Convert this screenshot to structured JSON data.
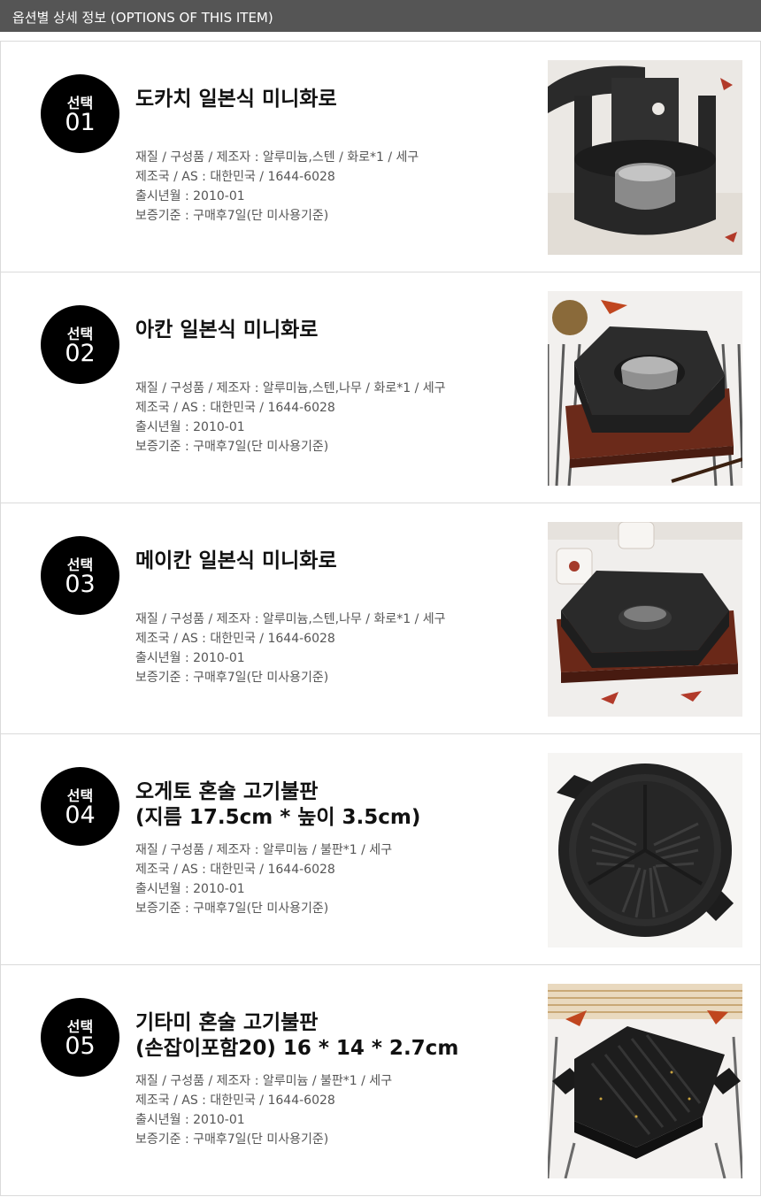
{
  "header": {
    "title": "옵션별 상세 정보 (OPTIONS OF THIS ITEM)"
  },
  "items": [
    {
      "badge_label": "선택",
      "number": "01",
      "title_line1": "도카치 일본식 미니화로",
      "title_line2": "",
      "specs": [
        "재질 / 구성품 / 제조자 : 알루미늄,스텐 / 화로*1 / 세구",
        "제조국 / AS : 대한민국 / 1644-6028",
        "출시년월 : 2010-01",
        "보증기준 : 구매후7일(단 미사용기준)"
      ],
      "photo_icon": "cylindrical-brazier-icon"
    },
    {
      "badge_label": "선택",
      "number": "02",
      "title_line1": "아칸 일본식 미니화로",
      "title_line2": "",
      "specs": [
        "재질 / 구성품 / 제조자 : 알루미늄,스텐,나무 / 화로*1 / 세구",
        "제조국 / AS : 대한민국 / 1644-6028",
        "출시년월 : 2010-01",
        "보증기준 : 구매후7일(단 미사용기준)"
      ],
      "photo_icon": "square-brazier-on-wood-icon"
    },
    {
      "badge_label": "선택",
      "number": "03",
      "title_line1": "메이칸 일본식 미니화로",
      "title_line2": "",
      "specs": [
        "재질 / 구성품 / 제조자 : 알루미늄,스텐,나무 / 화로*1 / 세구",
        "제조국 / AS : 대한민국 / 1644-6028",
        "출시년월 : 2010-01",
        "보증기준 : 구매후7일(단 미사용기준)"
      ],
      "photo_icon": "flat-brazier-on-wood-icon"
    },
    {
      "badge_label": "선택",
      "number": "04",
      "title_line1": "오게토 혼술 고기불판",
      "title_line2": "(지름 17.5cm * 높이 3.5cm)",
      "specs": [
        "재질 / 구성품 / 제조자 : 알루미늄 / 불판*1 / 세구",
        "제조국 / AS : 대한민국 / 1644-6028",
        "출시년월 : 2010-01",
        "보증기준 : 구매후7일(단 미사용기준)"
      ],
      "photo_icon": "round-grill-pan-icon"
    },
    {
      "badge_label": "선택",
      "number": "05",
      "title_line1": "기타미 혼술 고기불판",
      "title_line2": "(손잡이포함20) 16 * 14 * 2.7cm",
      "specs": [
        "재질 / 구성품 / 제조자 : 알루미늄 / 불판*1 / 세구",
        "제조국 / AS : 대한민국 / 1644-6028",
        "출시년월 : 2010-01",
        "보증기준 : 구매후7일(단 미사용기준)"
      ],
      "photo_icon": "square-grill-pan-icon"
    }
  ]
}
